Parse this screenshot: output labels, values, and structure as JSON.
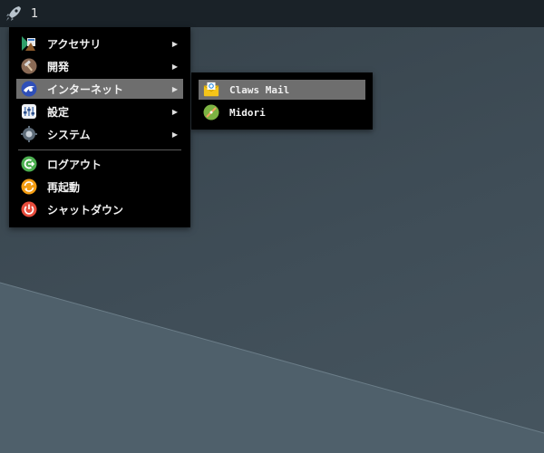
{
  "taskbar": {
    "launcher_icon": "rocket-icon",
    "workspace": "1"
  },
  "main_menu": {
    "items": [
      {
        "label": "アクセサリ",
        "icon": "accessories-icon",
        "has_submenu": true
      },
      {
        "label": "開発",
        "icon": "development-icon",
        "has_submenu": true
      },
      {
        "label": "インターネット",
        "icon": "internet-icon",
        "has_submenu": true,
        "highlighted": true
      },
      {
        "label": "設定",
        "icon": "settings-icon",
        "has_submenu": true
      },
      {
        "label": "システム",
        "icon": "system-icon",
        "has_submenu": true
      },
      {
        "label": "ログアウト",
        "icon": "logout-icon",
        "has_submenu": false
      },
      {
        "label": "再起動",
        "icon": "reboot-icon",
        "has_submenu": false
      },
      {
        "label": "シャットダウン",
        "icon": "shutdown-icon",
        "has_submenu": false
      }
    ],
    "submenu_arrow": "▶"
  },
  "sub_menu": {
    "items": [
      {
        "label": "Claws Mail",
        "icon": "claws-mail-icon",
        "highlighted": true
      },
      {
        "label": "Midori",
        "icon": "midori-icon"
      }
    ]
  },
  "colors": {
    "taskbar": "#1a2228",
    "menu_bg": "#000000",
    "highlight": "#6e6e6e",
    "desktop": "#3d4b55"
  }
}
